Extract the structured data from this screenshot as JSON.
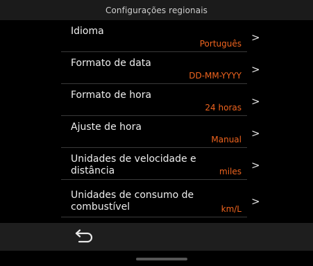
{
  "header": {
    "title": "Configurações regionais"
  },
  "items": [
    {
      "label": "Idioma",
      "value": "Português"
    },
    {
      "label": "Formato de data",
      "value": "DD-MM-YYYY"
    },
    {
      "label": "Formato de hora",
      "value": "24 horas"
    },
    {
      "label": "Ajuste de hora",
      "value": "Manual"
    },
    {
      "label": "Unidades de velocidade e\ndistância",
      "value": "miles"
    },
    {
      "label": "Unidades de consumo de\ncombustível",
      "value": "km/L"
    }
  ],
  "chevron": ">",
  "icons": {
    "back": "back-arrow-icon",
    "chevron": "chevron-right-icon"
  },
  "colors": {
    "accent": "#f0641e",
    "background": "#000000",
    "header": "#1b1b1b"
  }
}
